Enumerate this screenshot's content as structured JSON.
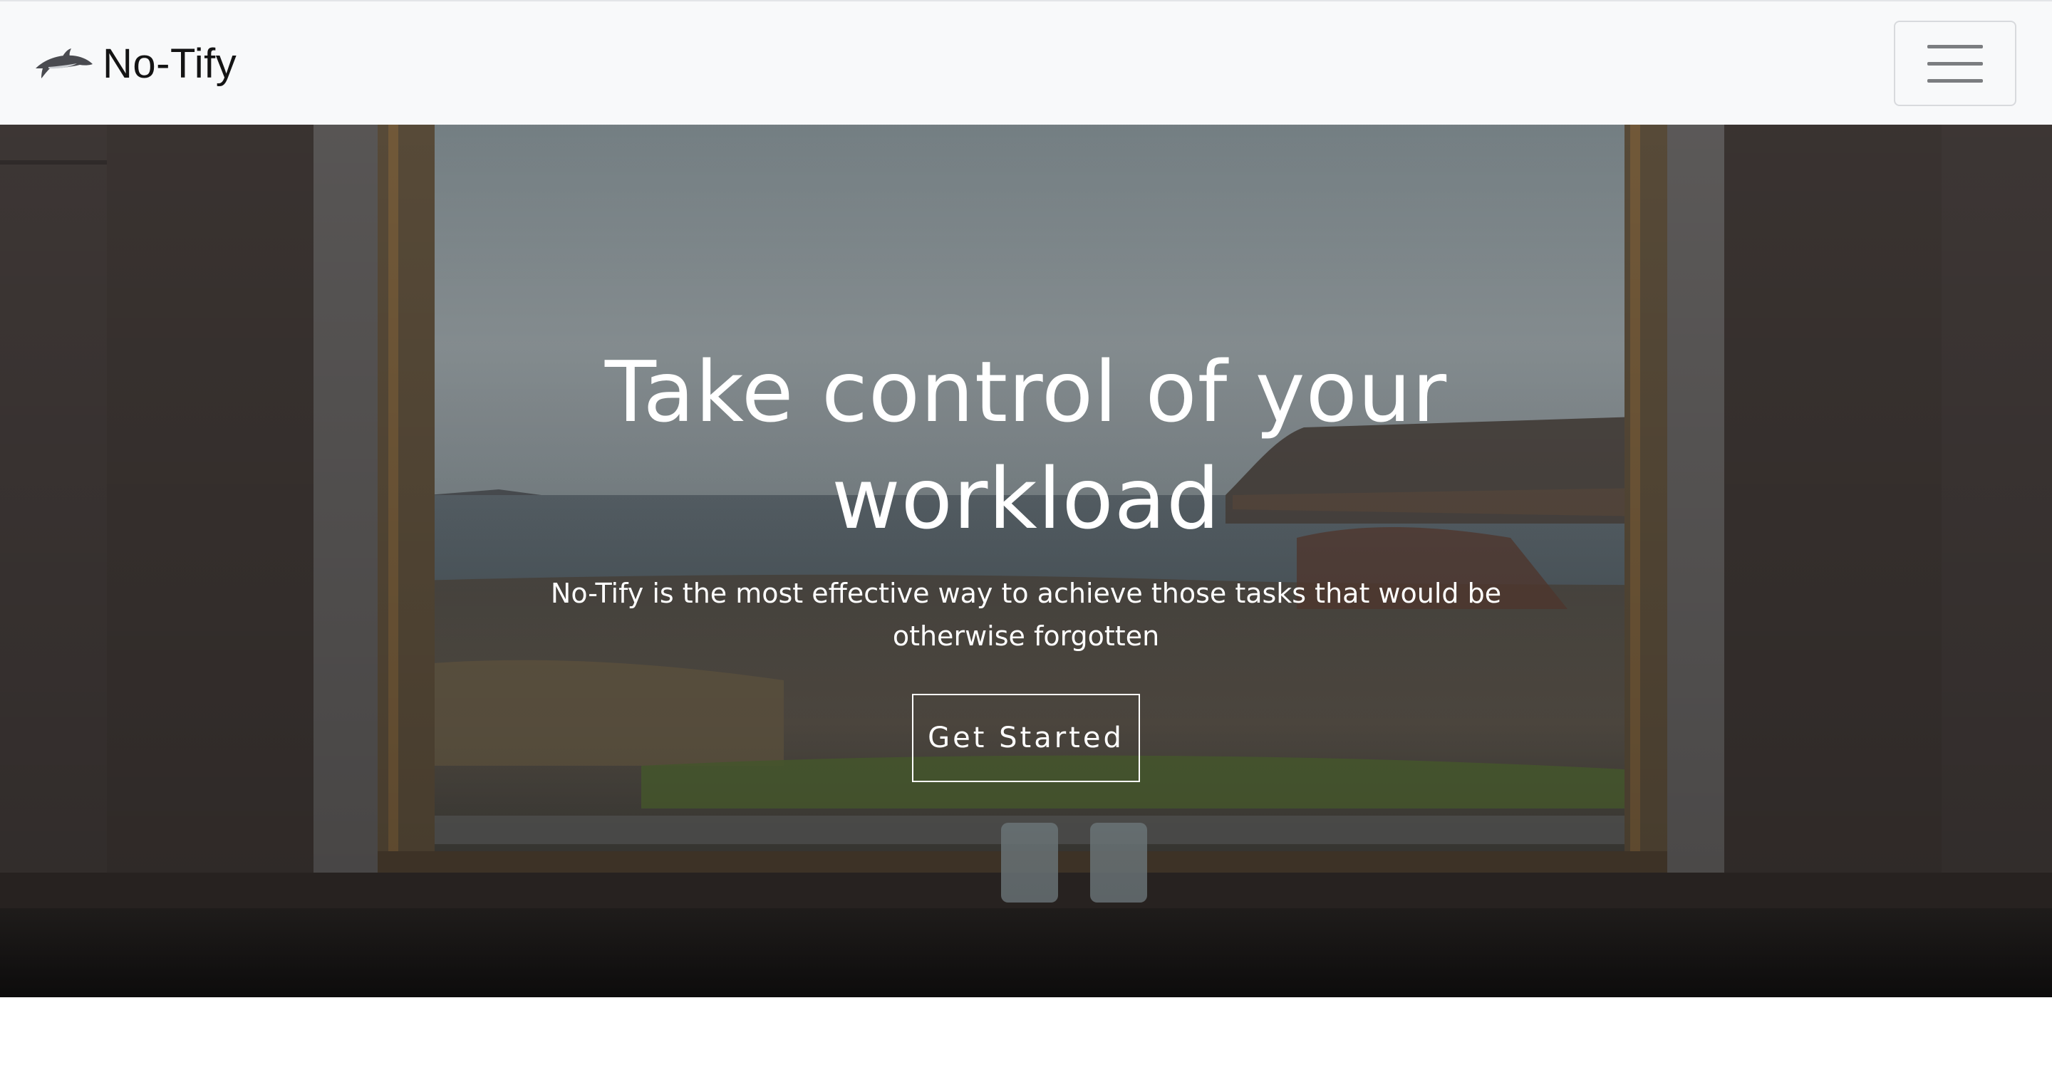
{
  "navbar": {
    "brand": {
      "name": "No-Tify",
      "logo_icon": "whale-icon"
    },
    "toggler_icon": "hamburger-menu-icon",
    "background": "#f8f9fa"
  },
  "hero": {
    "title": "Take control of your workload",
    "subtitle": "No-Tify is the most effective way to achieve those tasks that would be otherwise forgotten",
    "cta_label": "Get Started",
    "background_image": "window-view-of-coastal-landscape",
    "text_color": "#ffffff"
  }
}
